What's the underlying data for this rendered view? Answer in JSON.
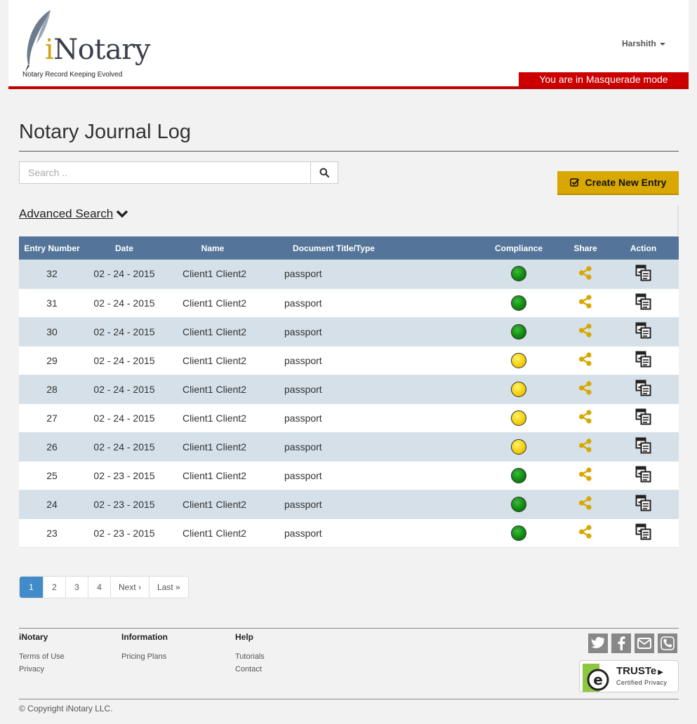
{
  "header": {
    "logo_text_i": "i",
    "logo_text_rest": "Notary",
    "logo_tagline": "Notary Record Keeping Evolved",
    "user_name": "Harshith",
    "masquerade_notice": "You are in Masquerade mode"
  },
  "main": {
    "page_title": "Notary Journal Log",
    "search": {
      "placeholder": "Search ..",
      "value": ""
    },
    "create_button_label": "Create New Entry",
    "advanced_search_label": "Advanced Search"
  },
  "table": {
    "headers": [
      "Entry Number",
      "Date",
      "Name",
      "Document Title/Type",
      "Compliance",
      "Share",
      "Action"
    ],
    "rows": [
      {
        "entry": "32",
        "date": "02 - 24 - 2015",
        "name": "Client1 Client2",
        "doc": "passport",
        "compliance": "green"
      },
      {
        "entry": "31",
        "date": "02 - 24 - 2015",
        "name": "Client1 Client2",
        "doc": "passport",
        "compliance": "green"
      },
      {
        "entry": "30",
        "date": "02 - 24 - 2015",
        "name": "Client1 Client2",
        "doc": "passport",
        "compliance": "green"
      },
      {
        "entry": "29",
        "date": "02 - 24 - 2015",
        "name": "Client1 Client2",
        "doc": "passport",
        "compliance": "yellow"
      },
      {
        "entry": "28",
        "date": "02 - 24 - 2015",
        "name": "Client1 Client2",
        "doc": "passport",
        "compliance": "yellow"
      },
      {
        "entry": "27",
        "date": "02 - 24 - 2015",
        "name": "Client1 Client2",
        "doc": "passport",
        "compliance": "yellow"
      },
      {
        "entry": "26",
        "date": "02 - 24 - 2015",
        "name": "Client1 Client2",
        "doc": "passport",
        "compliance": "yellow"
      },
      {
        "entry": "25",
        "date": "02 - 23 - 2015",
        "name": "Client1 Client2",
        "doc": "passport",
        "compliance": "green"
      },
      {
        "entry": "24",
        "date": "02 - 23 - 2015",
        "name": "Client1 Client2",
        "doc": "passport",
        "compliance": "green"
      },
      {
        "entry": "23",
        "date": "02 - 23 - 2015",
        "name": "Client1 Client2",
        "doc": "passport",
        "compliance": "green"
      }
    ]
  },
  "pagination": {
    "pages": [
      "1",
      "2",
      "3",
      "4"
    ],
    "active_page": "1",
    "next_label": "Next ›",
    "last_label": "Last »"
  },
  "footer": {
    "col1_title": "iNotary",
    "col1_links": [
      "Terms of Use",
      "Privacy"
    ],
    "col2_title": "Information",
    "col2_links": [
      "Pricing Plans"
    ],
    "col3_title": "Help",
    "col3_links": [
      "Tutorials",
      "Contact"
    ],
    "social_icons": [
      "twitter-icon",
      "facebook-icon",
      "mail-icon",
      "phone-icon"
    ],
    "truste_name": "TRUSTe",
    "truste_sub": "Certified Privacy",
    "copyright": "© Copyright iNotary LLC."
  },
  "colors": {
    "accent": "#d8a700",
    "header_rule": "#c00000",
    "table_header": "#547599",
    "row_stripe": "#d5e0e8",
    "compliance_green": "#0f8a0f",
    "compliance_yellow": "#f5cf10",
    "share_icon": "#d8a700"
  }
}
